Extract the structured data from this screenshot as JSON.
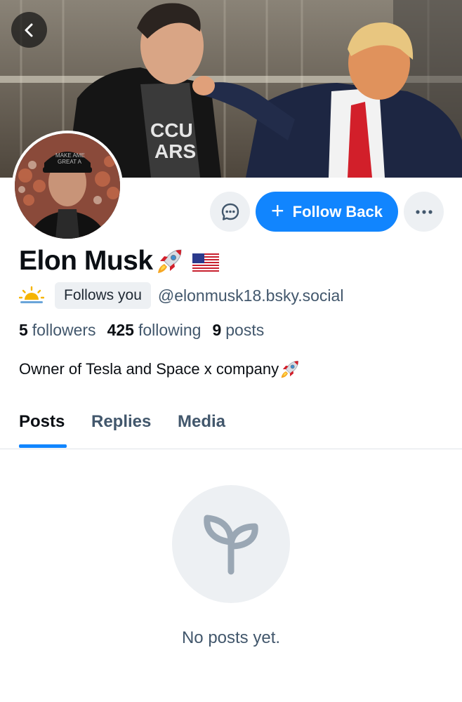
{
  "header": {
    "back_icon": "chevron-left-icon"
  },
  "profile": {
    "display_name": "Elon Musk",
    "handle": "@elonmusk18.bsky.social",
    "follows_you_label": "Follows you",
    "bio": "Owner of Tesla and Space x company",
    "name_emoji": [
      "rocket-emoji",
      "us-flag-emoji"
    ],
    "status_emoji": "sun-emoji"
  },
  "actions": {
    "message_icon": "chat-bubble-icon",
    "follow_back_label": "Follow Back",
    "follow_plus": "+",
    "more_icon": "ellipsis-icon",
    "accent_color": "#1185fe"
  },
  "stats": {
    "followers_count": "5",
    "followers_label": "followers",
    "following_count": "425",
    "following_label": "following",
    "posts_count": "9",
    "posts_label": "posts"
  },
  "tabs": [
    {
      "label": "Posts",
      "active": true
    },
    {
      "label": "Replies",
      "active": false
    },
    {
      "label": "Media",
      "active": false
    }
  ],
  "empty_state": {
    "icon": "sprout-icon",
    "message": "No posts yet."
  }
}
